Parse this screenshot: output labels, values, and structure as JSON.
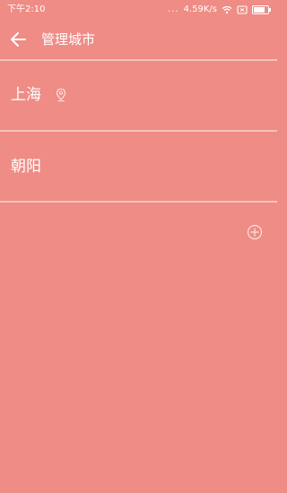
{
  "colors": {
    "background": "#ee8c85",
    "text": "#ffffff",
    "divider": "#f6c2be",
    "icon": "#ffffff",
    "icon_muted": "#fbe2e0"
  },
  "status_bar": {
    "time": "下午2:10",
    "signal_dots": "...",
    "network_speed": "4.59K/s",
    "icons": [
      "wifi-icon",
      "sim-icon",
      "battery-icon"
    ]
  },
  "header": {
    "back_icon": "arrow-left-icon",
    "title": "管理城市"
  },
  "cities": [
    {
      "name": "上海",
      "is_current_location": true,
      "location_icon": "location-pin-icon"
    },
    {
      "name": "朝阳",
      "is_current_location": false
    }
  ],
  "add_city": {
    "icon": "plus-circle-icon"
  }
}
